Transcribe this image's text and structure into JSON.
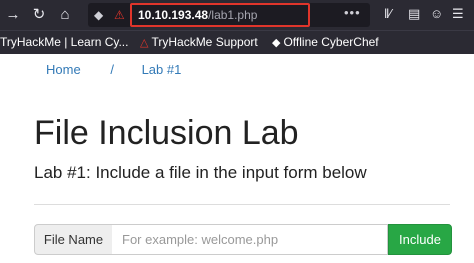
{
  "browser": {
    "back_icon": "arrow-left-icon",
    "reload_icon": "reload-icon",
    "home_icon": "home-icon",
    "url_host": "10.10.193.48",
    "url_path": "/lab1.php",
    "more_icon": "•••",
    "library_icon": "library-icon",
    "reader_icon": "sidebar-icon",
    "account_icon": "account-icon",
    "menu_icon": "hamburger-menu-icon"
  },
  "bookmarks": [
    {
      "label": "TryHackMe | Learn Cy..."
    },
    {
      "label": "TryHackMe Support"
    },
    {
      "label": "Offline CyberChef"
    }
  ],
  "breadcrumb": {
    "home": "Home",
    "separator": "/",
    "current": "Lab #1"
  },
  "page": {
    "title": "File Inclusion Lab",
    "subtitle": "Lab #1: Include a file in the input form below"
  },
  "form": {
    "addon_label": "File Name",
    "input_placeholder": "For example: welcome.php",
    "input_value": "",
    "submit_label": "Include"
  },
  "colors": {
    "toolbar_bg": "#2b2a33",
    "link": "#337ab7",
    "button_green": "#28a745",
    "url_highlight": "#e0352b"
  }
}
